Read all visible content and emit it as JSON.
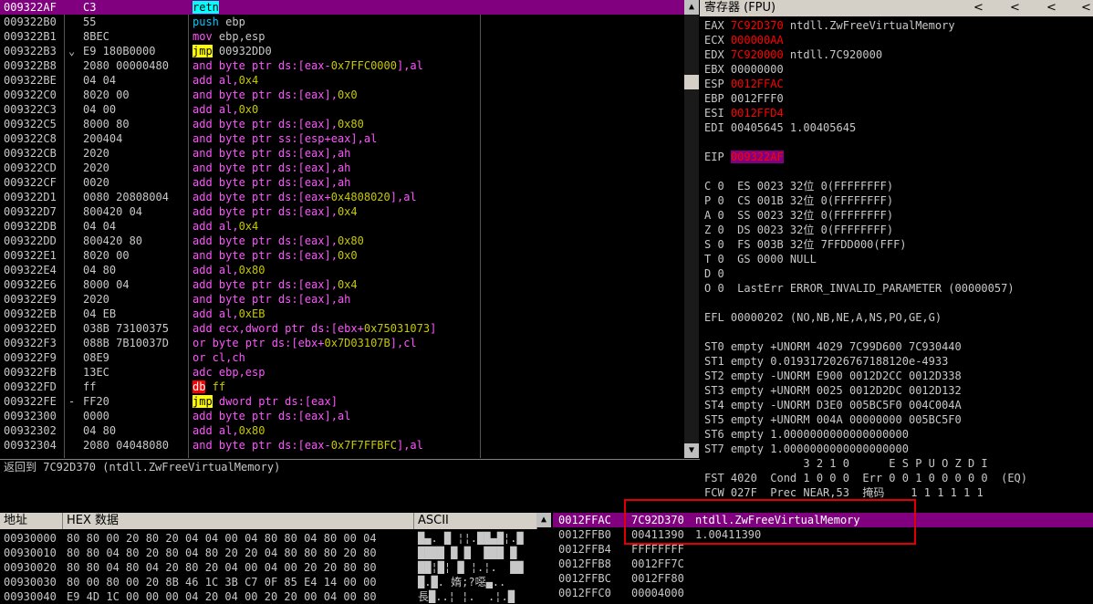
{
  "disasm": {
    "rows": [
      {
        "addr": "009322AF",
        "hex": "C3",
        "asm": [
          [
            "kw-call-retn",
            "retn"
          ]
        ],
        "sel": true
      },
      {
        "addr": "009322B0",
        "hex": "55",
        "asm": [
          [
            "kw-stack",
            "push"
          ],
          [
            "reg",
            " ebp"
          ]
        ]
      },
      {
        "addr": "009322B1",
        "hex": "8BEC",
        "asm": [
          [
            "kw-mov",
            "mov"
          ],
          [
            "reg",
            " ebp,esp"
          ]
        ]
      },
      {
        "addr": "009322B3",
        "arrow": "⌄",
        "hex": "E9 180B0000",
        "asm": [
          [
            "kw-jmp",
            "jmp"
          ],
          [
            "reg",
            " 00932DD0"
          ]
        ]
      },
      {
        "addr": "009322B8",
        "hex": "2080 00000480",
        "asm": [
          [
            "kw-mnem",
            "and byte ptr ds:[eax-"
          ],
          [
            "imm",
            "0x7FFC0000"
          ],
          [
            "kw-mnem",
            "],al"
          ]
        ]
      },
      {
        "addr": "009322BE",
        "hex": "04 04",
        "asm": [
          [
            "kw-mnem",
            "add al,"
          ],
          [
            "imm",
            "0x4"
          ]
        ]
      },
      {
        "addr": "009322C0",
        "hex": "8020 00",
        "asm": [
          [
            "kw-mnem",
            "and byte ptr ds:[eax],"
          ],
          [
            "imm",
            "0x0"
          ]
        ]
      },
      {
        "addr": "009322C3",
        "hex": "04 00",
        "asm": [
          [
            "kw-mnem",
            "add al,"
          ],
          [
            "imm",
            "0x0"
          ]
        ]
      },
      {
        "addr": "009322C5",
        "hex": "8000 80",
        "asm": [
          [
            "kw-mnem",
            "add byte ptr ds:[eax],"
          ],
          [
            "imm",
            "0x80"
          ]
        ]
      },
      {
        "addr": "009322C8",
        "hex": "200404",
        "asm": [
          [
            "kw-mnem",
            "and byte ptr ss:[esp+eax],al"
          ]
        ]
      },
      {
        "addr": "009322CB",
        "hex": "2020",
        "asm": [
          [
            "kw-mnem",
            "and byte ptr ds:[eax],ah"
          ]
        ]
      },
      {
        "addr": "009322CD",
        "hex": "2020",
        "asm": [
          [
            "kw-mnem",
            "and byte ptr ds:[eax],ah"
          ]
        ]
      },
      {
        "addr": "009322CF",
        "hex": "0020",
        "asm": [
          [
            "kw-mnem",
            "add byte ptr ds:[eax],ah"
          ]
        ]
      },
      {
        "addr": "009322D1",
        "hex": "0080 20808004",
        "asm": [
          [
            "kw-mnem",
            "add byte ptr ds:[eax+"
          ],
          [
            "imm",
            "0x4808020"
          ],
          [
            "kw-mnem",
            "],al"
          ]
        ]
      },
      {
        "addr": "009322D7",
        "hex": "800420 04",
        "asm": [
          [
            "kw-mnem",
            "add byte ptr ds:[eax],"
          ],
          [
            "imm",
            "0x4"
          ]
        ]
      },
      {
        "addr": "009322DB",
        "hex": "04 04",
        "asm": [
          [
            "kw-mnem",
            "add al,"
          ],
          [
            "imm",
            "0x4"
          ]
        ]
      },
      {
        "addr": "009322DD",
        "hex": "800420 80",
        "asm": [
          [
            "kw-mnem",
            "add byte ptr ds:[eax],"
          ],
          [
            "imm",
            "0x80"
          ]
        ]
      },
      {
        "addr": "009322E1",
        "hex": "8020 00",
        "asm": [
          [
            "kw-mnem",
            "and byte ptr ds:[eax],"
          ],
          [
            "imm",
            "0x0"
          ]
        ]
      },
      {
        "addr": "009322E4",
        "hex": "04 80",
        "asm": [
          [
            "kw-mnem",
            "add al,"
          ],
          [
            "imm",
            "0x80"
          ]
        ]
      },
      {
        "addr": "009322E6",
        "hex": "8000 04",
        "asm": [
          [
            "kw-mnem",
            "add byte ptr ds:[eax],"
          ],
          [
            "imm",
            "0x4"
          ]
        ]
      },
      {
        "addr": "009322E9",
        "hex": "2020",
        "asm": [
          [
            "kw-mnem",
            "and byte ptr ds:[eax],ah"
          ]
        ]
      },
      {
        "addr": "009322EB",
        "hex": "04 EB",
        "asm": [
          [
            "kw-mnem",
            "add al,"
          ],
          [
            "imm",
            "0xEB"
          ]
        ]
      },
      {
        "addr": "009322ED",
        "hex": "038B 73100375",
        "asm": [
          [
            "kw-mnem",
            "add ecx,dword ptr ds:[ebx+"
          ],
          [
            "imm",
            "0x75031073"
          ],
          [
            "kw-mnem",
            "]"
          ]
        ]
      },
      {
        "addr": "009322F3",
        "hex": "088B 7B10037D",
        "asm": [
          [
            "kw-or",
            "or byte ptr ds:[ebx+"
          ],
          [
            "imm",
            "0x7D03107B"
          ],
          [
            "kw-or",
            "],cl"
          ]
        ]
      },
      {
        "addr": "009322F9",
        "hex": "08E9",
        "asm": [
          [
            "kw-or",
            "or cl,ch"
          ]
        ]
      },
      {
        "addr": "009322FB",
        "hex": "13EC",
        "asm": [
          [
            "kw-adc",
            "adc ebp,esp"
          ]
        ]
      },
      {
        "addr": "009322FD",
        "hex": "ff",
        "asm": [
          [
            "kw-db",
            "db"
          ],
          [
            "imm",
            " ff"
          ]
        ]
      },
      {
        "addr": "009322FE",
        "arrow": "-",
        "hex": "FF20",
        "asm": [
          [
            "kw-jmp",
            "jmp"
          ],
          [
            "kw-mnem",
            " dword ptr ds:[eax]"
          ]
        ]
      },
      {
        "addr": "00932300",
        "hex": "0000",
        "asm": [
          [
            "kw-mnem",
            "add byte ptr ds:[eax],al"
          ]
        ]
      },
      {
        "addr": "00932302",
        "hex": "04 80",
        "asm": [
          [
            "kw-mnem",
            "add al,"
          ],
          [
            "imm",
            "0x80"
          ]
        ]
      },
      {
        "addr": "00932304",
        "hex": "2080 04048080",
        "asm": [
          [
            "kw-mnem",
            "and byte ptr ds:[eax-"
          ],
          [
            "imm",
            "0x7F7FFBFC"
          ],
          [
            "kw-mnem",
            "],al"
          ]
        ]
      }
    ]
  },
  "info_line": "返回到 7C92D370 (ntdll.ZwFreeVirtualMemory)",
  "registers": {
    "title": "寄存器 (FPU)",
    "nav": [
      "<",
      "<",
      "<",
      "<"
    ],
    "lines": [
      [
        [
          "n",
          "EAX "
        ],
        [
          "r",
          "7C92D370"
        ],
        [
          "n",
          " ntdll.ZwFreeVirtualMemory"
        ]
      ],
      [
        [
          "n",
          "ECX "
        ],
        [
          "r",
          "000000AA"
        ]
      ],
      [
        [
          "n",
          "EDX "
        ],
        [
          "r",
          "7C920000"
        ],
        [
          "n",
          " ntdll.7C920000"
        ]
      ],
      [
        [
          "n",
          "EBX 00000000"
        ]
      ],
      [
        [
          "n",
          "ESP "
        ],
        [
          "r",
          "0012FFAC"
        ]
      ],
      [
        [
          "n",
          "EBP 0012FFF0"
        ]
      ],
      [
        [
          "n",
          "ESI "
        ],
        [
          "r",
          "0012FFD4"
        ]
      ],
      [
        [
          "n",
          "EDI 00405645 1.00405645"
        ]
      ],
      [
        [
          "n",
          ""
        ]
      ],
      [
        [
          "n",
          "EIP "
        ],
        [
          "s",
          "009322AF"
        ]
      ],
      [
        [
          "n",
          ""
        ]
      ],
      [
        [
          "n",
          "C 0  ES 0023 32位 0(FFFFFFFF)"
        ]
      ],
      [
        [
          "n",
          "P 0  CS 001B 32位 0(FFFFFFFF)"
        ]
      ],
      [
        [
          "n",
          "A 0  SS 0023 32位 0(FFFFFFFF)"
        ]
      ],
      [
        [
          "n",
          "Z 0  DS 0023 32位 0(FFFFFFFF)"
        ]
      ],
      [
        [
          "n",
          "S 0  FS 003B 32位 7FFDD000(FFF)"
        ]
      ],
      [
        [
          "n",
          "T 0  GS 0000 NULL"
        ]
      ],
      [
        [
          "n",
          "D 0"
        ]
      ],
      [
        [
          "n",
          "O 0  LastErr ERROR_INVALID_PARAMETER (00000057)"
        ]
      ],
      [
        [
          "n",
          ""
        ]
      ],
      [
        [
          "n",
          "EFL 00000202 (NO,NB,NE,A,NS,PO,GE,G)"
        ]
      ],
      [
        [
          "n",
          ""
        ]
      ],
      [
        [
          "n",
          "ST0 empty +UNORM 4029 7C99D600 7C930440"
        ]
      ],
      [
        [
          "n",
          "ST1 empty 0.0193172026767188120e-4933"
        ]
      ],
      [
        [
          "n",
          "ST2 empty -UNORM E900 0012D2CC 0012D338"
        ]
      ],
      [
        [
          "n",
          "ST3 empty +UNORM 0025 0012D2DC 0012D132"
        ]
      ],
      [
        [
          "n",
          "ST4 empty -UNORM D3E0 005BC5F0 004C004A"
        ]
      ],
      [
        [
          "n",
          "ST5 empty +UNORM 004A 00000000 005BC5F0"
        ]
      ],
      [
        [
          "n",
          "ST6 empty 1.0000000000000000000"
        ]
      ],
      [
        [
          "n",
          "ST7 empty 1.0000000000000000000"
        ]
      ],
      [
        [
          "n",
          "               3 2 1 0      E S P U O Z D I"
        ]
      ],
      [
        [
          "n",
          "FST 4020  Cond 1 0 0 0  Err 0 0 1 0 0 0 0 0  (EQ)"
        ]
      ],
      [
        [
          "n",
          "FCW 027F  Prec NEAR,53  掩码    1 1 1 1 1 1"
        ]
      ]
    ]
  },
  "hexdump": {
    "headers": [
      "地址",
      "HEX 数据",
      "ASCII"
    ],
    "rows": [
      {
        "addr": "00930000",
        "hex": "80 80 00 20 80 20 04 04 00 04 80 80 04 80 00 04",
        "ascii": "█▄. █ ¦¦.██▄█¦.█"
      },
      {
        "addr": "00930010",
        "hex": "80 80 04 80 20 80 04 80 20 20 04 80 80 80 20 80",
        "ascii": "████ █ █  ███ █"
      },
      {
        "addr": "00930020",
        "hex": "80 80 04 80 04 20 80 20 04 00 04 00 20 20 80 80",
        "ascii": "██¦█¦ █ ¦.¦.  ██"
      },
      {
        "addr": "00930030",
        "hex": "80 00 80 00 20 8B 46 1C 3B C7 0F 85 E4 14 00 00",
        "ascii": "█.█. 媠;?噁▄.."
      },
      {
        "addr": "00930040",
        "hex": "E9 4D 1C 00 00 00 04 20 04 00 20 20 00 04 00 80",
        "ascii": "長█..¦ ¦.  .¦.█"
      }
    ]
  },
  "stack": {
    "rows": [
      {
        "addr": "0012FFAC",
        "val": "7C92D370",
        "cmt": "ntdll.ZwFreeVirtualMemory",
        "sel": true
      },
      {
        "addr": "0012FFB0",
        "val": "00411390",
        "cmt": "1.00411390"
      },
      {
        "addr": "0012FFB4",
        "val": "FFFFFFFF",
        "cmt": ""
      },
      {
        "addr": "0012FFB8",
        "val": "0012FF7C",
        "cmt": ""
      },
      {
        "addr": "0012FFBC",
        "val": "0012FF80",
        "cmt": ""
      },
      {
        "addr": "0012FFC0",
        "val": "00004000",
        "cmt": ""
      }
    ]
  }
}
